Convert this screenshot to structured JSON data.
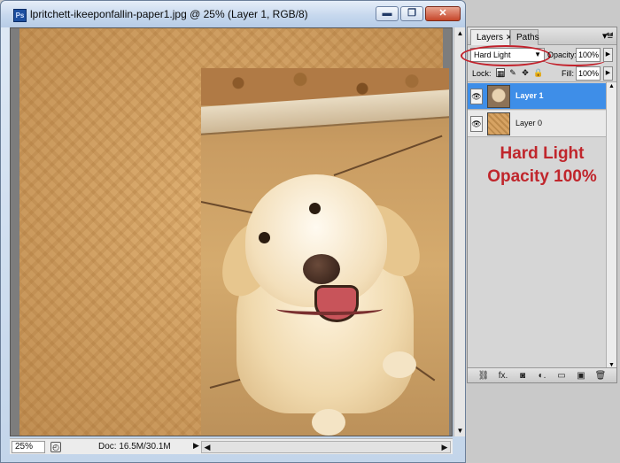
{
  "document": {
    "title": "lpritchett-ikeeponfallin-paper1.jpg @ 25% (Layer 1, RGB/8)",
    "app_icon_text": "Ps",
    "window_buttons": {
      "minimize": "▬",
      "maximize": "❐",
      "close": "✕"
    },
    "status": {
      "zoom": "25%",
      "doc_size": "Doc: 16.5M/30.1M",
      "arrow": "▶"
    }
  },
  "layers_panel": {
    "tabs": [
      {
        "label": "Layers",
        "close": "✕"
      },
      {
        "label": "Paths"
      }
    ],
    "menu_icon": "▾≡",
    "collapse_icon": "◂◂",
    "blend_mode": "Hard Light",
    "opacity_label": "Opacity:",
    "opacity_value": "100%",
    "lock_label": "Lock:",
    "lock_icons": {
      "transparent": "▦",
      "paint": "✎",
      "move": "✥",
      "all": "🔒"
    },
    "fill_label": "Fill:",
    "fill_value": "100%",
    "layers": [
      {
        "name": "Layer 1",
        "selected": true,
        "visible": true
      },
      {
        "name": "Layer 0",
        "selected": false,
        "visible": true
      }
    ],
    "annotation": {
      "line1": "Hard Light",
      "line2": "Opacity 100%",
      "color": "#c0262c"
    },
    "bottom_icons": [
      "link-icon",
      "fx-icon",
      "mask-icon",
      "adjustment-icon",
      "group-icon",
      "new-layer-icon",
      "trash-icon"
    ],
    "bottom_icon_glyphs": [
      "⛓",
      "fx.",
      "◙",
      "◐.",
      "▭",
      "▣",
      "🗑"
    ]
  },
  "colors": {
    "selection_blue": "#3e8ee8",
    "annotation_red": "#c0262c",
    "paper_tan": "#d9a768"
  }
}
